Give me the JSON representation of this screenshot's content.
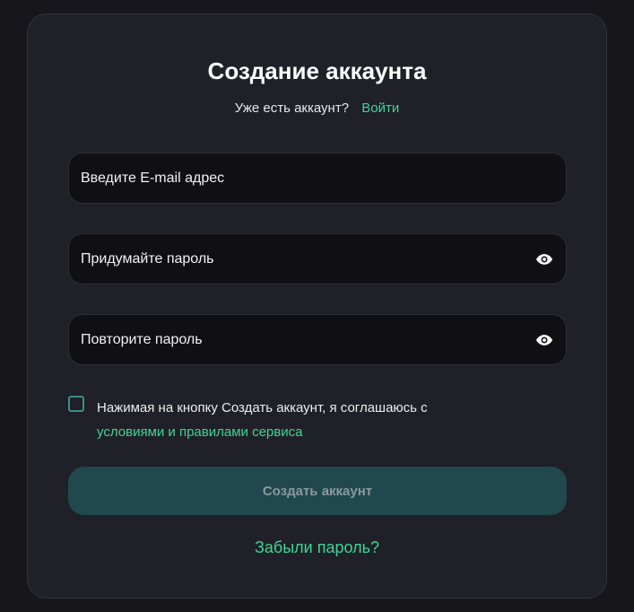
{
  "signup": {
    "title": "Создание аккаунта",
    "have_account_text": "Уже есть аккаунт?",
    "login_link": "Войти",
    "email": {
      "placeholder": "Введите E-mail адрес",
      "value": ""
    },
    "password": {
      "placeholder": "Придумайте пароль",
      "value": "",
      "icon": "eye-icon"
    },
    "repeat_password": {
      "placeholder": "Повторите пароль",
      "value": "",
      "icon": "eye-icon"
    },
    "agreement": {
      "checked": false,
      "text": "Нажимая на кнопку Создать аккаунт, я соглашаюсь с",
      "terms_link": "условиями и правилами сервиса"
    },
    "submit_label": "Создать аккаунт",
    "forgot_password": "Забыли пароль?"
  },
  "colors": {
    "background": "#16161b",
    "card": "#202028",
    "input": "#101014",
    "accent": "#3fd596",
    "button": "#21484f",
    "button_text": "#8a9a9c"
  }
}
